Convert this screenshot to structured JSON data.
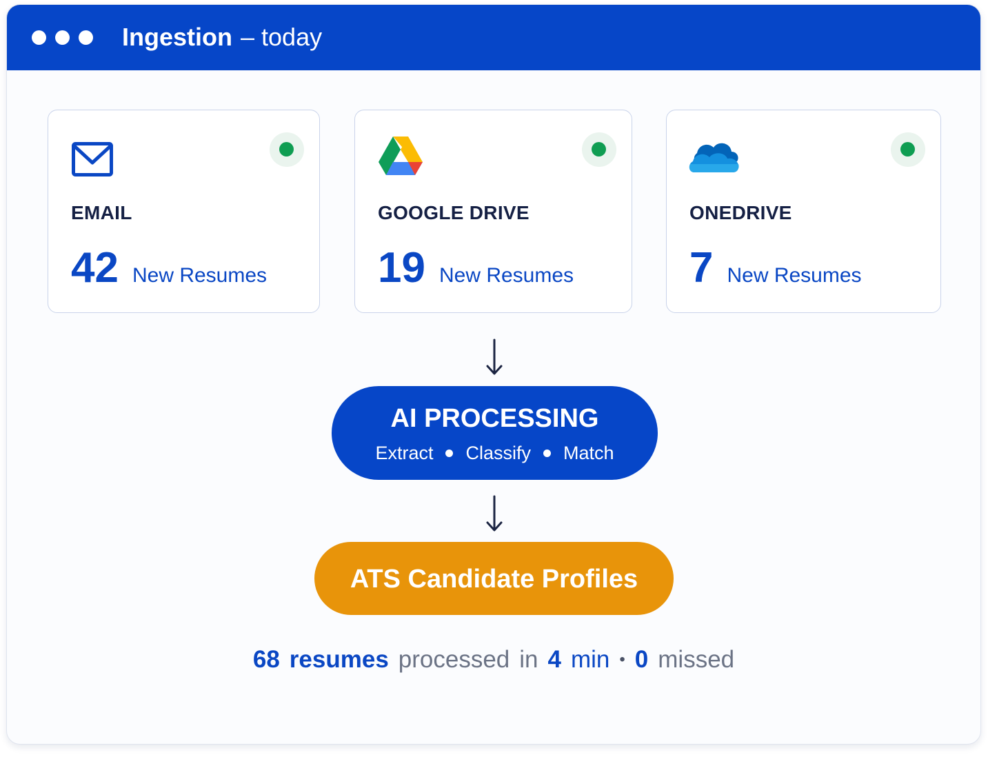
{
  "window": {
    "title": "Ingestion",
    "separator": "–",
    "subtitle": "today"
  },
  "sources": [
    {
      "name": "EMAIL",
      "count": "42",
      "unit": "New Resumes",
      "status": "active",
      "icon": "mail-icon"
    },
    {
      "name": "GOOGLE DRIVE",
      "count": "19",
      "unit": "New Resumes",
      "status": "active",
      "icon": "google-drive-icon"
    },
    {
      "name": "ONEDRIVE",
      "count": "7",
      "unit": "New Resumes",
      "status": "active",
      "icon": "onedrive-icon"
    }
  ],
  "processing": {
    "title": "AI PROCESSING",
    "steps": [
      "Extract",
      "Classify",
      "Match"
    ]
  },
  "destination": {
    "title": "ATS Candidate Profiles"
  },
  "summary": {
    "total": "68",
    "total_label": "resumes",
    "processed_text": "processed",
    "in_text": "in",
    "duration": "4",
    "duration_unit": "min",
    "separator": "•",
    "missed": "0",
    "missed_label": "missed"
  },
  "colors": {
    "primary": "#0646c8",
    "accent_orange": "#e8940a",
    "status_green": "#0f9d52",
    "text_dark": "#152044",
    "text_muted": "#6b7385"
  }
}
